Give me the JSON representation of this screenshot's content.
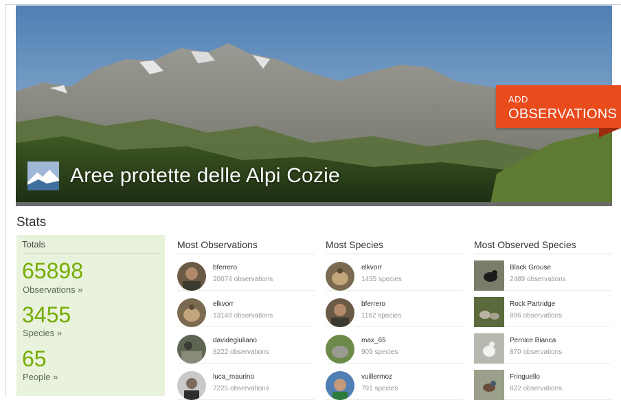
{
  "place": {
    "title": "Aree protette delle Alpi Cozie",
    "logo_icon": "mountain-landscape-logo"
  },
  "add_button": {
    "line1": "ADD",
    "line2": "OBSERVATIONS",
    "color": "#ea4b1d"
  },
  "stats": {
    "heading": "Stats",
    "totals": {
      "header": "Totals",
      "observations_count": "65898",
      "observations_label": "Observations »",
      "species_count": "3455",
      "species_label": "Species »",
      "people_count": "65",
      "people_label": "People »"
    }
  },
  "most_observations": {
    "header": "Most Observations",
    "items": [
      {
        "name": "bferrero",
        "count": "20074 observations"
      },
      {
        "name": "elkvorr",
        "count": "13140 observations"
      },
      {
        "name": "davidegiuliano",
        "count": "8222 observations"
      },
      {
        "name": "luca_maurino",
        "count": "7225 observations"
      }
    ]
  },
  "most_species": {
    "header": "Most Species",
    "items": [
      {
        "name": "elkvorr",
        "count": "1435 species"
      },
      {
        "name": "bferrero",
        "count": "1162 species"
      },
      {
        "name": "max_65",
        "count": "909 species"
      },
      {
        "name": "vuillermoz",
        "count": "791 species"
      }
    ]
  },
  "most_observed_species": {
    "header": "Most Observed Species",
    "items": [
      {
        "name": "Black Grouse",
        "count": "2489 observations"
      },
      {
        "name": "Rock Partridge",
        "count": "896 observations"
      },
      {
        "name": "Pernice Bianca",
        "count": "870 observations"
      },
      {
        "name": "Fringuello",
        "count": "822 observations"
      }
    ]
  },
  "colors": {
    "accent_green": "#74ac00",
    "totals_bg": "#e9f2dc"
  }
}
